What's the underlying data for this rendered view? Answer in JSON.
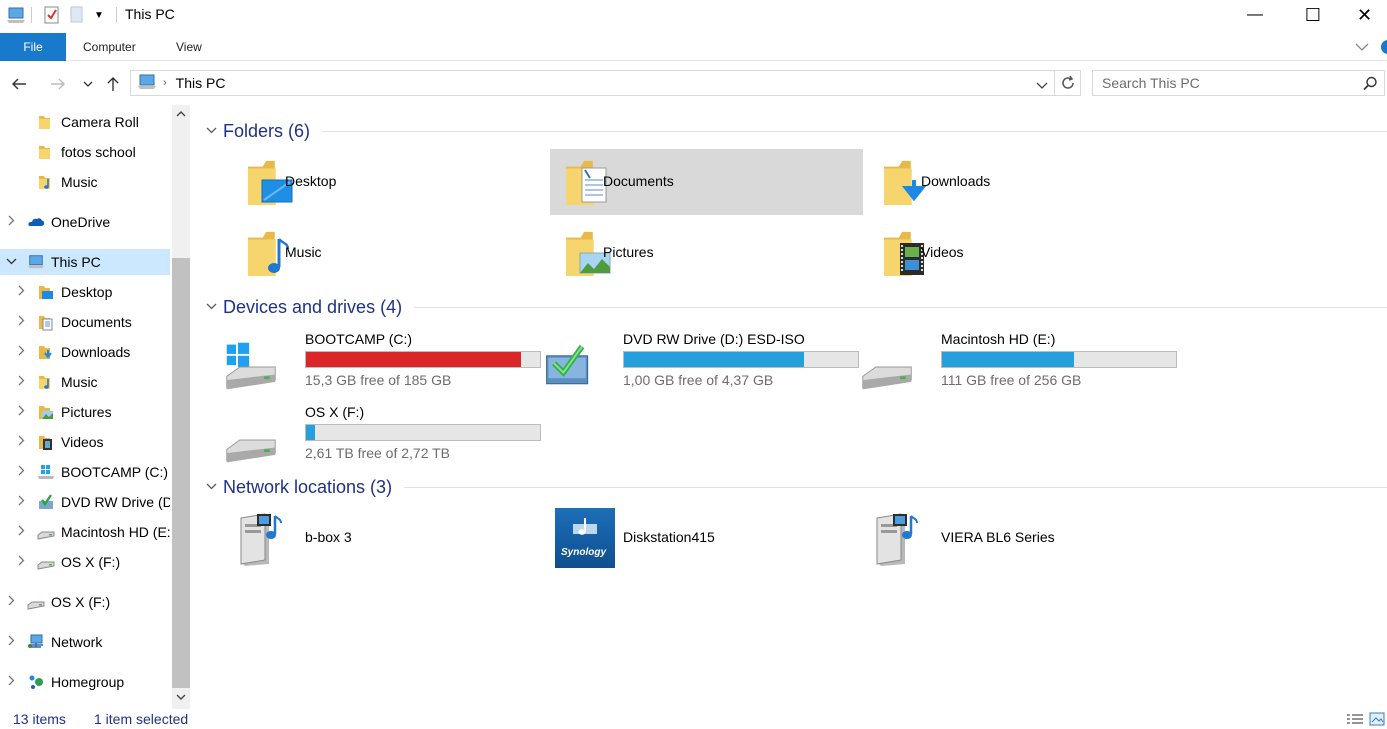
{
  "window": {
    "title": "This PC",
    "minimize_glyph": "—",
    "maximize_glyph": "☐",
    "close_glyph": "✕"
  },
  "ribbon": {
    "tabs": [
      "File",
      "Computer",
      "View"
    ]
  },
  "address": {
    "path": "This PC",
    "search_placeholder": "Search This PC"
  },
  "nav_pane": {
    "items": [
      {
        "label": "Camera Roll",
        "icon": "folder-icon",
        "expandable": false
      },
      {
        "label": "fotos school",
        "icon": "folder-icon",
        "expandable": false
      },
      {
        "label": "Music",
        "icon": "music-folder-icon",
        "expandable": false
      },
      {
        "label": "OneDrive",
        "icon": "onedrive-icon",
        "expandable": true
      },
      {
        "label": "This PC",
        "icon": "computer-icon",
        "expandable": true,
        "expanded": true,
        "selected": true
      },
      {
        "label": "Desktop",
        "icon": "desktop-folder-icon",
        "expandable": true
      },
      {
        "label": "Documents",
        "icon": "documents-folder-icon",
        "expandable": true
      },
      {
        "label": "Downloads",
        "icon": "downloads-folder-icon",
        "expandable": true
      },
      {
        "label": "Music",
        "icon": "music-folder-icon",
        "expandable": true
      },
      {
        "label": "Pictures",
        "icon": "pictures-folder-icon",
        "expandable": true
      },
      {
        "label": "Videos",
        "icon": "videos-folder-icon",
        "expandable": true
      },
      {
        "label": "BOOTCAMP (C:)",
        "icon": "windows-drive-icon",
        "expandable": true
      },
      {
        "label": "DVD RW Drive (D:) ESD-ISO",
        "icon": "dvd-drive-icon",
        "expandable": true
      },
      {
        "label": "Macintosh HD (E:)",
        "icon": "hard-drive-icon",
        "expandable": true
      },
      {
        "label": "OS X (F:)",
        "icon": "hard-drive-icon",
        "expandable": true
      },
      {
        "label": "OS X (F:)",
        "icon": "hard-drive-icon",
        "expandable": true
      },
      {
        "label": "Network",
        "icon": "network-icon",
        "expandable": true
      },
      {
        "label": "Homegroup",
        "icon": "homegroup-icon",
        "expandable": true
      }
    ]
  },
  "groups": {
    "folders": {
      "title": "Folders (6)",
      "items": [
        {
          "label": "Desktop",
          "icon": "desktop-folder-icon"
        },
        {
          "label": "Documents",
          "icon": "documents-folder-icon",
          "selected": true
        },
        {
          "label": "Downloads",
          "icon": "downloads-folder-icon"
        },
        {
          "label": "Music",
          "icon": "music-folder-icon"
        },
        {
          "label": "Pictures",
          "icon": "pictures-folder-icon"
        },
        {
          "label": "Videos",
          "icon": "videos-folder-icon"
        }
      ]
    },
    "drives": {
      "title": "Devices and drives (4)",
      "items": [
        {
          "label": "BOOTCAMP (C:)",
          "free_text": "15,3 GB free of 185 GB",
          "used_fraction": 0.917,
          "bar_color": "#da2626",
          "icon": "windows-drive-icon"
        },
        {
          "label": "DVD RW Drive (D:) ESD-ISO",
          "free_text": "1,00 GB free of 4,37 GB",
          "used_fraction": 0.771,
          "bar_color": "#26a0da",
          "icon": "dvd-drive-icon"
        },
        {
          "label": "Macintosh HD (E:)",
          "free_text": "111 GB free of 256 GB",
          "used_fraction": 0.566,
          "bar_color": "#26a0da",
          "icon": "hard-drive-icon"
        },
        {
          "label": "OS X (F:)",
          "free_text": "2,61 TB free of 2,72 TB",
          "used_fraction": 0.04,
          "bar_color": "#26a0da",
          "icon": "hard-drive-icon"
        }
      ]
    },
    "network": {
      "title": "Network locations (3)",
      "items": [
        {
          "label": "b-box 3",
          "icon": "media-server-icon"
        },
        {
          "label": "Diskstation415",
          "icon": "synology-icon",
          "logo_text": "Synology"
        },
        {
          "label": "VIERA BL6 Series",
          "icon": "media-server-icon"
        }
      ]
    }
  },
  "status": {
    "item_count": "13 items",
    "selection": "1 item selected"
  },
  "colors": {
    "accent": "#1979ca",
    "selection": "#cce8ff",
    "group_title": "#1e3287",
    "drive_ok": "#26a0da",
    "drive_full": "#da2626"
  }
}
